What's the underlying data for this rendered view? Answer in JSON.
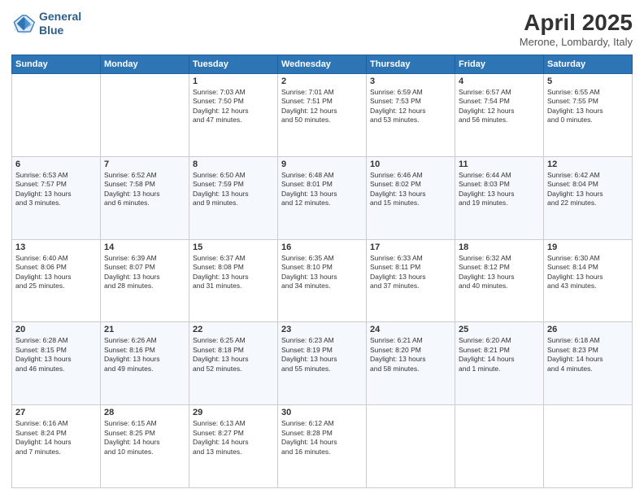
{
  "header": {
    "logo_line1": "General",
    "logo_line2": "Blue",
    "month_title": "April 2025",
    "location": "Merone, Lombardy, Italy"
  },
  "weekdays": [
    "Sunday",
    "Monday",
    "Tuesday",
    "Wednesday",
    "Thursday",
    "Friday",
    "Saturday"
  ],
  "weeks": [
    [
      {
        "day": "",
        "info": ""
      },
      {
        "day": "",
        "info": ""
      },
      {
        "day": "1",
        "info": "Sunrise: 7:03 AM\nSunset: 7:50 PM\nDaylight: 12 hours\nand 47 minutes."
      },
      {
        "day": "2",
        "info": "Sunrise: 7:01 AM\nSunset: 7:51 PM\nDaylight: 12 hours\nand 50 minutes."
      },
      {
        "day": "3",
        "info": "Sunrise: 6:59 AM\nSunset: 7:53 PM\nDaylight: 12 hours\nand 53 minutes."
      },
      {
        "day": "4",
        "info": "Sunrise: 6:57 AM\nSunset: 7:54 PM\nDaylight: 12 hours\nand 56 minutes."
      },
      {
        "day": "5",
        "info": "Sunrise: 6:55 AM\nSunset: 7:55 PM\nDaylight: 13 hours\nand 0 minutes."
      }
    ],
    [
      {
        "day": "6",
        "info": "Sunrise: 6:53 AM\nSunset: 7:57 PM\nDaylight: 13 hours\nand 3 minutes."
      },
      {
        "day": "7",
        "info": "Sunrise: 6:52 AM\nSunset: 7:58 PM\nDaylight: 13 hours\nand 6 minutes."
      },
      {
        "day": "8",
        "info": "Sunrise: 6:50 AM\nSunset: 7:59 PM\nDaylight: 13 hours\nand 9 minutes."
      },
      {
        "day": "9",
        "info": "Sunrise: 6:48 AM\nSunset: 8:01 PM\nDaylight: 13 hours\nand 12 minutes."
      },
      {
        "day": "10",
        "info": "Sunrise: 6:46 AM\nSunset: 8:02 PM\nDaylight: 13 hours\nand 15 minutes."
      },
      {
        "day": "11",
        "info": "Sunrise: 6:44 AM\nSunset: 8:03 PM\nDaylight: 13 hours\nand 19 minutes."
      },
      {
        "day": "12",
        "info": "Sunrise: 6:42 AM\nSunset: 8:04 PM\nDaylight: 13 hours\nand 22 minutes."
      }
    ],
    [
      {
        "day": "13",
        "info": "Sunrise: 6:40 AM\nSunset: 8:06 PM\nDaylight: 13 hours\nand 25 minutes."
      },
      {
        "day": "14",
        "info": "Sunrise: 6:39 AM\nSunset: 8:07 PM\nDaylight: 13 hours\nand 28 minutes."
      },
      {
        "day": "15",
        "info": "Sunrise: 6:37 AM\nSunset: 8:08 PM\nDaylight: 13 hours\nand 31 minutes."
      },
      {
        "day": "16",
        "info": "Sunrise: 6:35 AM\nSunset: 8:10 PM\nDaylight: 13 hours\nand 34 minutes."
      },
      {
        "day": "17",
        "info": "Sunrise: 6:33 AM\nSunset: 8:11 PM\nDaylight: 13 hours\nand 37 minutes."
      },
      {
        "day": "18",
        "info": "Sunrise: 6:32 AM\nSunset: 8:12 PM\nDaylight: 13 hours\nand 40 minutes."
      },
      {
        "day": "19",
        "info": "Sunrise: 6:30 AM\nSunset: 8:14 PM\nDaylight: 13 hours\nand 43 minutes."
      }
    ],
    [
      {
        "day": "20",
        "info": "Sunrise: 6:28 AM\nSunset: 8:15 PM\nDaylight: 13 hours\nand 46 minutes."
      },
      {
        "day": "21",
        "info": "Sunrise: 6:26 AM\nSunset: 8:16 PM\nDaylight: 13 hours\nand 49 minutes."
      },
      {
        "day": "22",
        "info": "Sunrise: 6:25 AM\nSunset: 8:18 PM\nDaylight: 13 hours\nand 52 minutes."
      },
      {
        "day": "23",
        "info": "Sunrise: 6:23 AM\nSunset: 8:19 PM\nDaylight: 13 hours\nand 55 minutes."
      },
      {
        "day": "24",
        "info": "Sunrise: 6:21 AM\nSunset: 8:20 PM\nDaylight: 13 hours\nand 58 minutes."
      },
      {
        "day": "25",
        "info": "Sunrise: 6:20 AM\nSunset: 8:21 PM\nDaylight: 14 hours\nand 1 minute."
      },
      {
        "day": "26",
        "info": "Sunrise: 6:18 AM\nSunset: 8:23 PM\nDaylight: 14 hours\nand 4 minutes."
      }
    ],
    [
      {
        "day": "27",
        "info": "Sunrise: 6:16 AM\nSunset: 8:24 PM\nDaylight: 14 hours\nand 7 minutes."
      },
      {
        "day": "28",
        "info": "Sunrise: 6:15 AM\nSunset: 8:25 PM\nDaylight: 14 hours\nand 10 minutes."
      },
      {
        "day": "29",
        "info": "Sunrise: 6:13 AM\nSunset: 8:27 PM\nDaylight: 14 hours\nand 13 minutes."
      },
      {
        "day": "30",
        "info": "Sunrise: 6:12 AM\nSunset: 8:28 PM\nDaylight: 14 hours\nand 16 minutes."
      },
      {
        "day": "",
        "info": ""
      },
      {
        "day": "",
        "info": ""
      },
      {
        "day": "",
        "info": ""
      }
    ]
  ]
}
